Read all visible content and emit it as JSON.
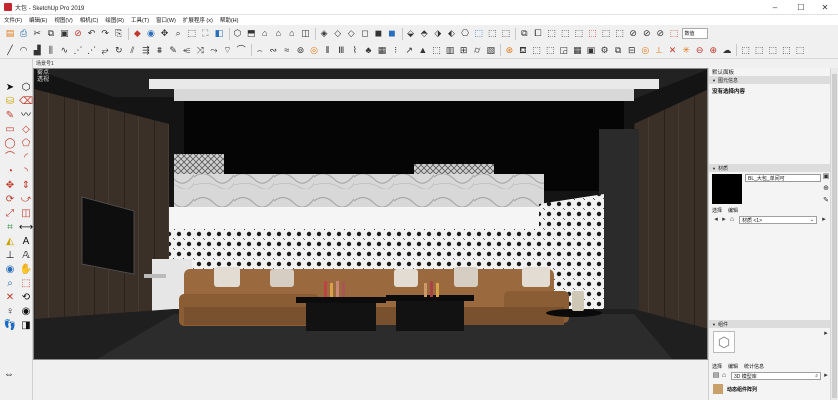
{
  "window": {
    "title": "大包 - SketchUp Pro 2019",
    "controls": [
      "–",
      "☐",
      "✕"
    ]
  },
  "menubar": {
    "items": [
      "文件(F)",
      "编辑(E)",
      "视图(V)",
      "相机(C)",
      "绘图(R)",
      "工具(T)",
      "窗口(W)",
      "扩展程序 (x)",
      "帮助(H)"
    ]
  },
  "toolbar": {
    "value_box": "数值"
  },
  "scene": {
    "tab": "场景号1",
    "label_line1": "雾点",
    "label_line2": "透视"
  },
  "tray": {
    "title": "默认面板",
    "entity_info": {
      "header": "图元信息",
      "empty_text": "没有选择内容"
    },
    "materials": {
      "header": "材质",
      "material_name": "BL_大包_单间可",
      "tab_select": "选择",
      "tab_edit": "编辑",
      "collection": "材质 <1>"
    },
    "components": {
      "header": "组件",
      "tab_select": "选择",
      "tab_edit": "编辑",
      "tab_stats": "统计信息",
      "search_placeholder": "3D 模型库",
      "item_label": "动态组件阵列"
    }
  },
  "colors": {
    "logo": "#c1272d",
    "viewport_bg": "#151515",
    "sofa": "#9a6a3e",
    "wood": "#3b3027",
    "panel_header": "#dcdcdc"
  }
}
